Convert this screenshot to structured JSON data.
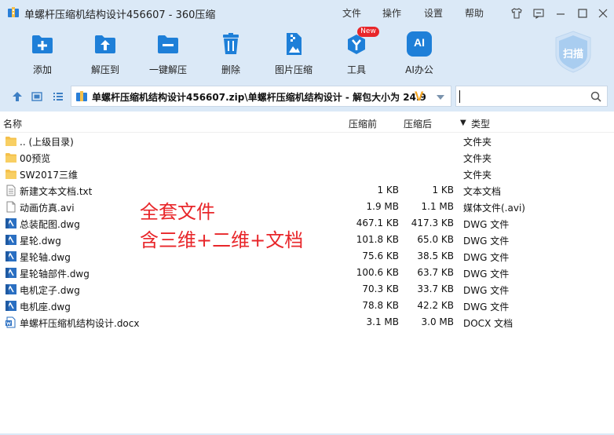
{
  "window": {
    "title": "单螺杆压缩机结构设计456607 - 360压缩"
  },
  "menu": [
    "文件",
    "操作",
    "设置",
    "帮助"
  ],
  "toolbar": [
    {
      "label": "添加",
      "icon": "add-icon"
    },
    {
      "label": "解压到",
      "icon": "extract-to-icon"
    },
    {
      "label": "一键解压",
      "icon": "one-click-extract-icon"
    },
    {
      "label": "删除",
      "icon": "delete-icon"
    },
    {
      "label": "图片压缩",
      "icon": "image-compress-icon"
    },
    {
      "label": "工具",
      "icon": "tools-icon",
      "badge": "New"
    },
    {
      "label": "AI办公",
      "icon": "ai-office-icon",
      "icon_text": "AI"
    }
  ],
  "scan": {
    "label": "扫描"
  },
  "address": {
    "path": "单螺杆压缩机结构设计456607.zip\\单螺杆压缩机结构设计 - 解包大小为 24.9",
    "v_badge": "V"
  },
  "search": {
    "placeholder": ""
  },
  "columns": {
    "name": "名称",
    "compressed": "压缩前",
    "original": "压缩后",
    "type": "类型",
    "sort_arrow": "▼"
  },
  "files": [
    {
      "name": ".. (上级目录)",
      "compressed": "",
      "original": "",
      "type": "文件夹",
      "kind": "folder"
    },
    {
      "name": "00预览",
      "compressed": "",
      "original": "",
      "type": "文件夹",
      "kind": "folder"
    },
    {
      "name": "SW2017三维",
      "compressed": "",
      "original": "",
      "type": "文件夹",
      "kind": "folder"
    },
    {
      "name": "新建文本文档.txt",
      "compressed": "1 KB",
      "original": "1 KB",
      "type": "文本文档",
      "kind": "txt"
    },
    {
      "name": "动画仿真.avi",
      "compressed": "1.9 MB",
      "original": "1.1 MB",
      "type": "媒体文件(.avi)",
      "kind": "avi"
    },
    {
      "name": "总装配图.dwg",
      "compressed": "467.1 KB",
      "original": "417.3 KB",
      "type": "DWG 文件",
      "kind": "dwg"
    },
    {
      "name": "星轮.dwg",
      "compressed": "101.8 KB",
      "original": "65.0 KB",
      "type": "DWG 文件",
      "kind": "dwg"
    },
    {
      "name": "星轮轴.dwg",
      "compressed": "75.6 KB",
      "original": "38.5 KB",
      "type": "DWG 文件",
      "kind": "dwg"
    },
    {
      "name": "星轮轴部件.dwg",
      "compressed": "100.6 KB",
      "original": "63.7 KB",
      "type": "DWG 文件",
      "kind": "dwg"
    },
    {
      "name": "电机定子.dwg",
      "compressed": "70.3 KB",
      "original": "33.7 KB",
      "type": "DWG 文件",
      "kind": "dwg"
    },
    {
      "name": "电机座.dwg",
      "compressed": "78.8 KB",
      "original": "42.2 KB",
      "type": "DWG 文件",
      "kind": "dwg"
    },
    {
      "name": "单螺杆压缩机结构设计.docx",
      "compressed": "3.1 MB",
      "original": "3.0 MB",
      "type": "DOCX 文档",
      "kind": "docx"
    }
  ],
  "overlay": {
    "line1": "全套文件",
    "line2": "含三维+二维+文档"
  },
  "colors": {
    "accent": "#1e7fd8",
    "overlay": "#e8262a",
    "folder": "#f5c04a",
    "chrome": "#dbe9f7"
  }
}
